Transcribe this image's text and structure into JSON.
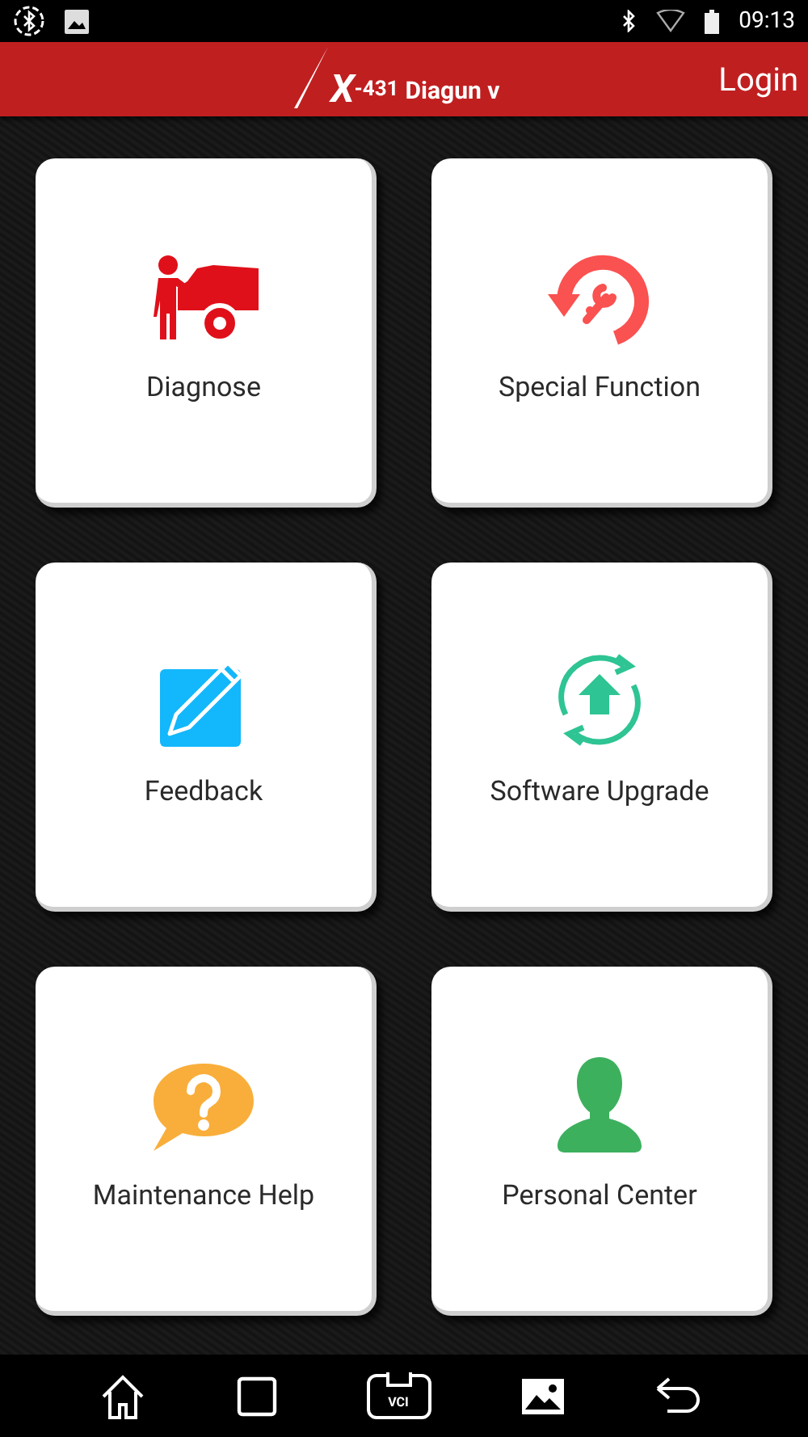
{
  "status_bar": {
    "time": "09:13"
  },
  "header": {
    "logo": {
      "mark": "X",
      "model": "-431",
      "name": "Diagun v"
    },
    "login": "Login"
  },
  "tiles": [
    {
      "label": "Diagnose",
      "kind": "mechanic"
    },
    {
      "label": "Special Function",
      "kind": "wrench"
    },
    {
      "label": "Feedback",
      "kind": "edit"
    },
    {
      "label": "Software Upgrade",
      "kind": "upgrade"
    },
    {
      "label": "Maintenance Help",
      "kind": "help"
    },
    {
      "label": "Personal Center",
      "kind": "person"
    }
  ],
  "nav_bar": {
    "vci_label": "VCI"
  }
}
